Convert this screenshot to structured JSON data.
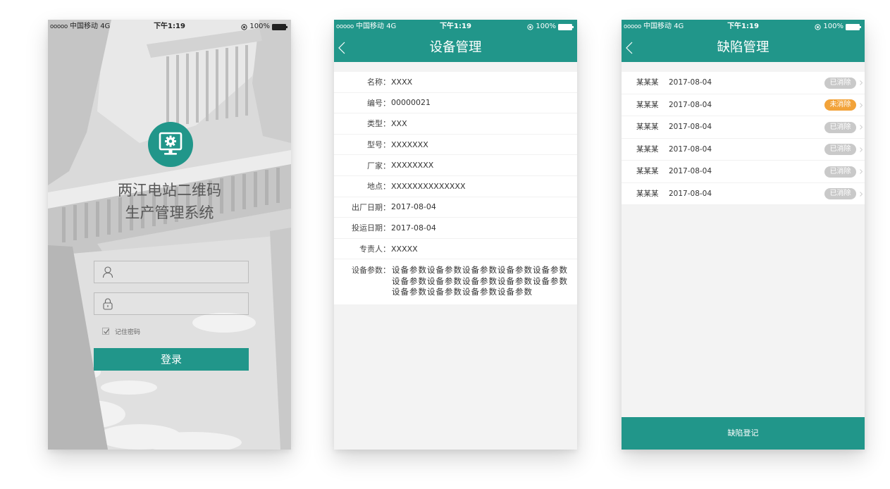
{
  "colors": {
    "primary": "#21968a",
    "status_done": "#c9c9c9",
    "status_pending": "#f2a33a",
    "page_background": "#f3f3f3"
  },
  "status_bar": {
    "signal": "ooooo",
    "carrier": "中国移动 4G",
    "time": "下午1:19",
    "battery": "100%"
  },
  "login": {
    "logo_icon": "monitor-gear-icon",
    "title_line1": "两江电站二维码",
    "title_line2": "生产管理系统",
    "username_icon": "user-icon",
    "password_icon": "lock-icon",
    "remember_password": {
      "label": "记住密码",
      "checked": true
    },
    "login_button": "登录"
  },
  "equipment": {
    "title": "设备管理",
    "fields": [
      {
        "label": "名称：",
        "value": "XXXX"
      },
      {
        "label": "编号：",
        "value": "00000021"
      },
      {
        "label": "类型：",
        "value": "XXX"
      },
      {
        "label": "型号：",
        "value": "XXXXXXX"
      },
      {
        "label": "厂家：",
        "value": "XXXXXXXX"
      },
      {
        "label": "地点：",
        "value": "XXXXXXXXXXXXXX"
      },
      {
        "label": "出厂日期：",
        "value": "2017-08-04"
      },
      {
        "label": "投运日期：",
        "value": "2017-08-04"
      },
      {
        "label": "专责人：",
        "value": "XXXXX"
      }
    ],
    "parameters": {
      "label": "设备参数：",
      "lines": [
        "设备参数设备参数设备参数设备参数设备参数",
        "设备参数设备参数设备参数设备参数设备参数",
        "设备参数设备参数设备参数设备参数"
      ]
    }
  },
  "defects": {
    "title": "缺陷管理",
    "items": [
      {
        "name": "某某某",
        "date": "2017-08-04",
        "status": "已消除",
        "pending": false
      },
      {
        "name": "某某某",
        "date": "2017-08-04",
        "status": "未消除",
        "pending": true
      },
      {
        "name": "某某某",
        "date": "2017-08-04",
        "status": "已消除",
        "pending": false
      },
      {
        "name": "某某某",
        "date": "2017-08-04",
        "status": "已消除",
        "pending": false
      },
      {
        "name": "某某某",
        "date": "2017-08-04",
        "status": "已消除",
        "pending": false
      },
      {
        "name": "某某某",
        "date": "2017-08-04",
        "status": "已消除",
        "pending": false
      }
    ],
    "register_button": "缺陷登记"
  }
}
